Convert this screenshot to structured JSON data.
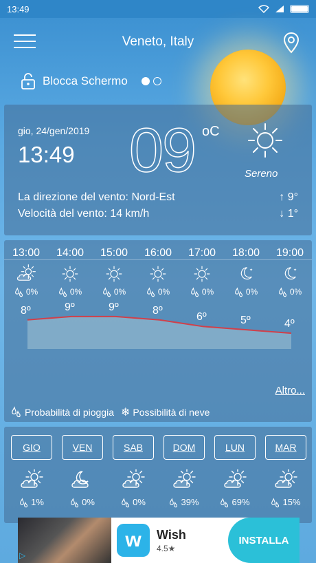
{
  "status": {
    "time": "13:49"
  },
  "header": {
    "location": "Veneto, Italy"
  },
  "lock": {
    "label": "Blocca Schermo"
  },
  "current": {
    "date": "gio, 24/gen/2019",
    "time": "13:49",
    "temp": "09",
    "unit": "oC",
    "condition": "Sereno",
    "wind_dir_label": "La direzione del vento: Nord-Est",
    "wind_speed_label": "Velocità del vento: 14 km/h",
    "wind_r1": "↑  9°",
    "wind_r2": "↓  1°"
  },
  "hourly": [
    {
      "time": "13:00",
      "icon": "partly-cloudy-icon",
      "rain": "0%",
      "temp": "8º"
    },
    {
      "time": "14:00",
      "icon": "sun-icon",
      "rain": "0%",
      "temp": "9º"
    },
    {
      "time": "15:00",
      "icon": "sun-icon",
      "rain": "0%",
      "temp": "9º"
    },
    {
      "time": "16:00",
      "icon": "sun-icon",
      "rain": "0%",
      "temp": "8º"
    },
    {
      "time": "17:00",
      "icon": "sun-icon",
      "rain": "0%",
      "temp": "6º"
    },
    {
      "time": "18:00",
      "icon": "moon-icon",
      "rain": "0%",
      "temp": "5º"
    },
    {
      "time": "19:00",
      "icon": "moon-icon",
      "rain": "0%",
      "temp": "4º"
    }
  ],
  "more_label": "Altro...",
  "legend": {
    "rain": "Probabilità di pioggia",
    "snow": "Possibilità di neve"
  },
  "daily": [
    {
      "day": "GIO",
      "icon": "partly-cloudy-icon",
      "rain": "1%"
    },
    {
      "day": "VEN",
      "icon": "moon-cloud-icon",
      "rain": "0%"
    },
    {
      "day": "SAB",
      "icon": "partly-cloudy-icon",
      "rain": "0%"
    },
    {
      "day": "DOM",
      "icon": "partly-cloudy-icon",
      "rain": "39%"
    },
    {
      "day": "LUN",
      "icon": "partly-cloudy-icon",
      "rain": "69%"
    },
    {
      "day": "MAR",
      "icon": "partly-cloudy-icon",
      "rain": "15%"
    }
  ],
  "ad": {
    "title": "Wish",
    "rating": "4.5★",
    "install": "INSTALLA",
    "logo_letter": "w"
  },
  "colors": {
    "temp_line": "#d0404a",
    "graph_fill": "#8fb5cc"
  }
}
